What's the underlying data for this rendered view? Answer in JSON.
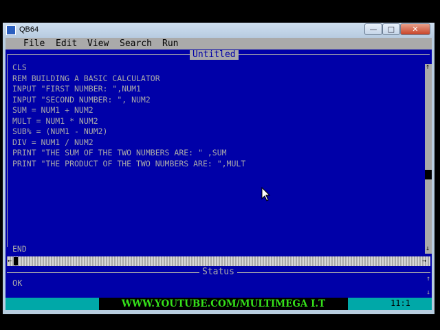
{
  "window": {
    "title": "QB64",
    "minimize": "—",
    "maximize": "□",
    "close": "✕"
  },
  "menu": [
    "File",
    "Edit",
    "View",
    "Search",
    "Run"
  ],
  "editor": {
    "title": "Untitled",
    "lines": [
      "CLS",
      "REM BUILDING A BASIC CALCULATOR",
      "INPUT \"FIRST NUMBER: \",NUM1",
      "INPUT \"SECOND NUMBER: \", NUM2",
      "SUM = NUM1 + NUM2",
      "MULT = NUM1 * NUM2",
      "SUB% = (NUM1 - NUM2)",
      "DIV = NUM1 / NUM2",
      "PRINT \"THE SUM OF THE TWO NUMBERS ARE: \" ,SUM",
      "PRINT \"THE PRODUCT OF THE TWO NUMBERS ARE: \",MULT",
      "",
      "",
      "",
      "",
      "",
      "",
      "",
      "END"
    ],
    "scroll_up_arrow": "↑",
    "scroll_down_arrow": "↓",
    "scroll_left_arrow": "←",
    "scroll_right_arrow": "→"
  },
  "status": {
    "title": "Status",
    "text": "OK",
    "up_arrow": "↑",
    "down_arrow": "↓"
  },
  "bottom": {
    "watermark": "WWW.YOUTUBE.COM/MULTIMEGA I.T SCHOOL",
    "cursor_position": "11:1"
  },
  "colors": {
    "editor_bg": "#0000a8",
    "editor_text": "#aaaaaa",
    "menubar_bg": "#aaaaaa",
    "bottombar_bg": "#00a8a8",
    "watermark_text": "#35e01a"
  }
}
